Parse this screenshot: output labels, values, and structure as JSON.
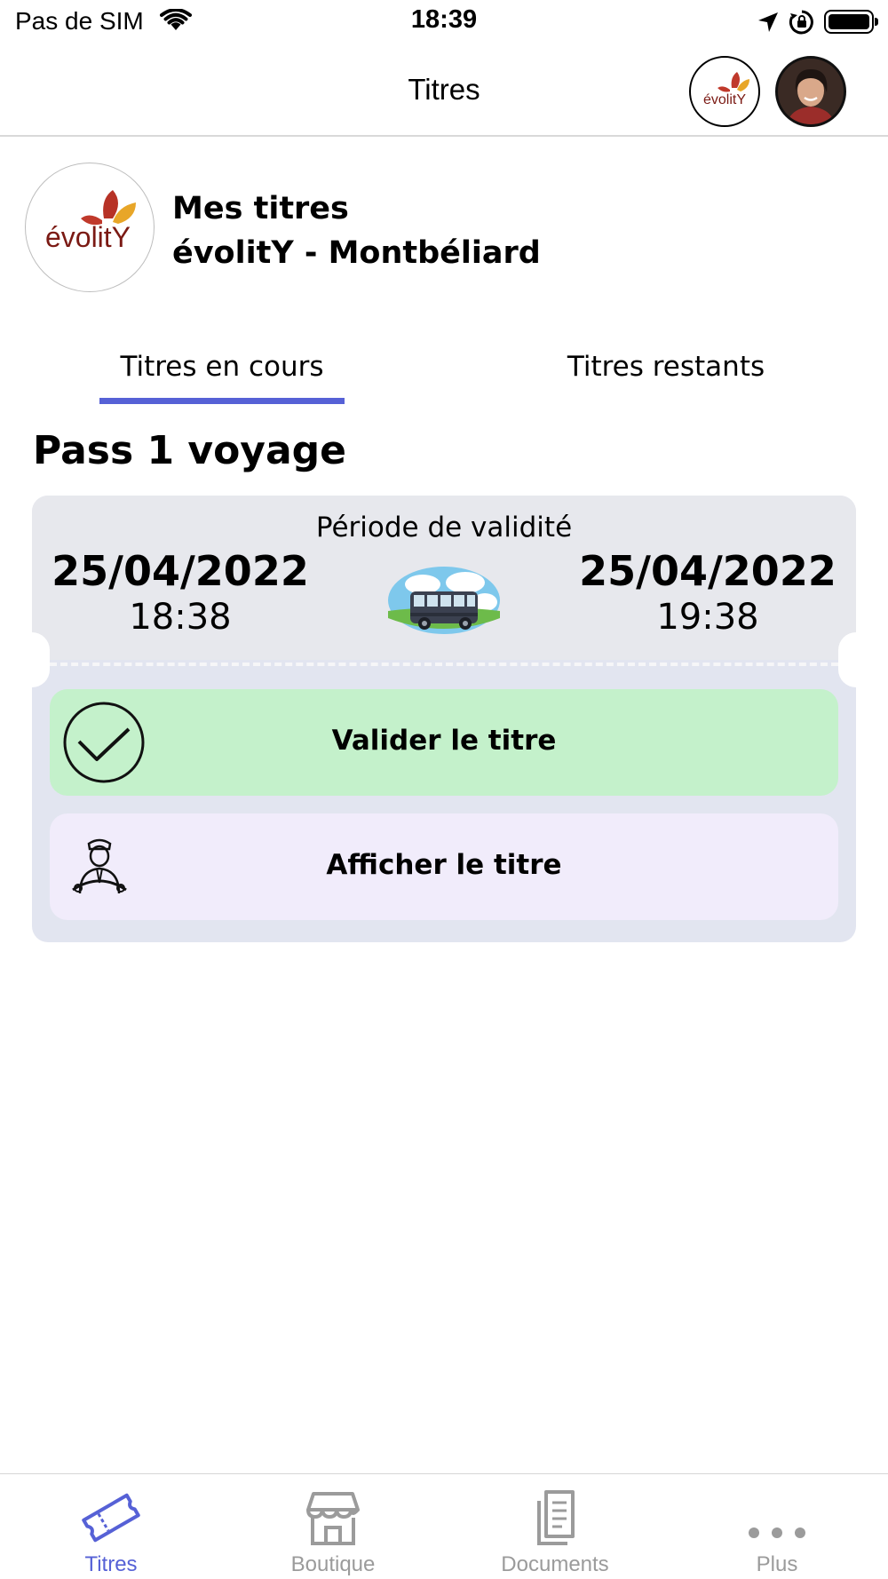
{
  "status_bar": {
    "carrier": "Pas de SIM",
    "time": "18:39"
  },
  "nav": {
    "title": "Titres"
  },
  "network": {
    "title_line1": "Mes titres",
    "title_line2": "évolitY - Montbéliard",
    "logo_text": "évolitY"
  },
  "tabs": [
    {
      "label": "Titres en cours",
      "active": true
    },
    {
      "label": "Titres restants",
      "active": false
    }
  ],
  "pass": {
    "title": "Pass 1 voyage",
    "validity_label": "Période de validité",
    "start_date": "25/04/2022",
    "start_time": "18:38",
    "end_date": "25/04/2022",
    "end_time": "19:38",
    "validate_label": "Valider le titre",
    "show_label": "Afficher le titre"
  },
  "tab_bar": [
    {
      "label": "Titres",
      "icon": "ticket-icon",
      "active": true
    },
    {
      "label": "Boutique",
      "icon": "shop-icon",
      "active": false
    },
    {
      "label": "Documents",
      "icon": "documents-icon",
      "active": false
    },
    {
      "label": "Plus",
      "icon": "more-icon",
      "active": false
    }
  ],
  "colors": {
    "accent": "#5661d6",
    "validate_bg": "#c4f1cb",
    "show_bg": "#f1ecfb",
    "ticket_bg": "#e2e5f0"
  }
}
